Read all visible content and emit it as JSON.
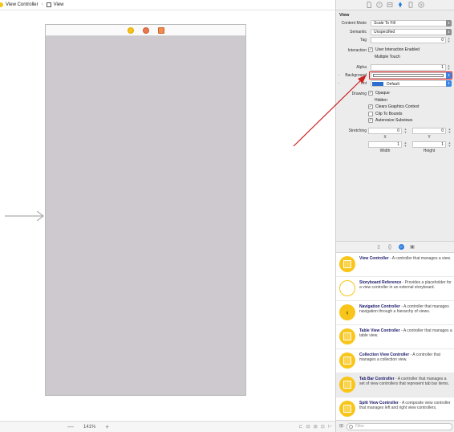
{
  "breadcrumb": {
    "items": [
      "View Controller",
      "View"
    ]
  },
  "canvas": {
    "zoom": "141%"
  },
  "inspector": {
    "section_title": "View",
    "content_mode": {
      "label": "Content Mode",
      "value": "Scale To Fill"
    },
    "semantic": {
      "label": "Semantic",
      "value": "Unspecified"
    },
    "tag": {
      "label": "Tag",
      "value": "0"
    },
    "interaction": {
      "label": "Interaction",
      "user_interaction": "User Interaction Enabled",
      "multiple_touch": "Multiple Touch"
    },
    "alpha": {
      "label": "Alpha",
      "value": "1"
    },
    "background": {
      "label": "Background"
    },
    "tint": {
      "label": "Tint",
      "value": "Default",
      "color": "#2c6fcf"
    },
    "drawing": {
      "label": "Drawing",
      "opaque": "Opaque",
      "hidden": "Hidden",
      "clears_graphics": "Clears Graphics Context",
      "clip_to_bounds": "Clip To Bounds",
      "autoresize": "Autoresize Subviews"
    },
    "stretching": {
      "label": "Stretching",
      "x": "0",
      "y": "0",
      "width": "1",
      "height": "1",
      "x_label": "X",
      "y_label": "Y",
      "width_label": "Width",
      "height_label": "Height"
    }
  },
  "library": {
    "items": [
      {
        "title": "View Controller",
        "desc": " - A controller that manages a view."
      },
      {
        "title": "Storyboard Reference",
        "desc": " - Provides a placeholder for a view controller in an external storyboard."
      },
      {
        "title": "Navigation Controller",
        "desc": " - A controller that manages navigation through a hierarchy of views."
      },
      {
        "title": "Table View Controller",
        "desc": " - A controller that manages a table view."
      },
      {
        "title": "Collection View Controller",
        "desc": " - A controller that manages a collection view."
      },
      {
        "title": "Tab Bar Controller",
        "desc": " - A controller that manages a set of view controllers that represent tab bar items."
      },
      {
        "title": "Split View Controller",
        "desc": " - A composite view controller that manages left and right view controllers."
      }
    ],
    "filter_placeholder": "Filter"
  },
  "colors": {
    "accent": "#2f7de1",
    "annotation": "#cc2222",
    "scene_bg": "#cdc9cf"
  }
}
